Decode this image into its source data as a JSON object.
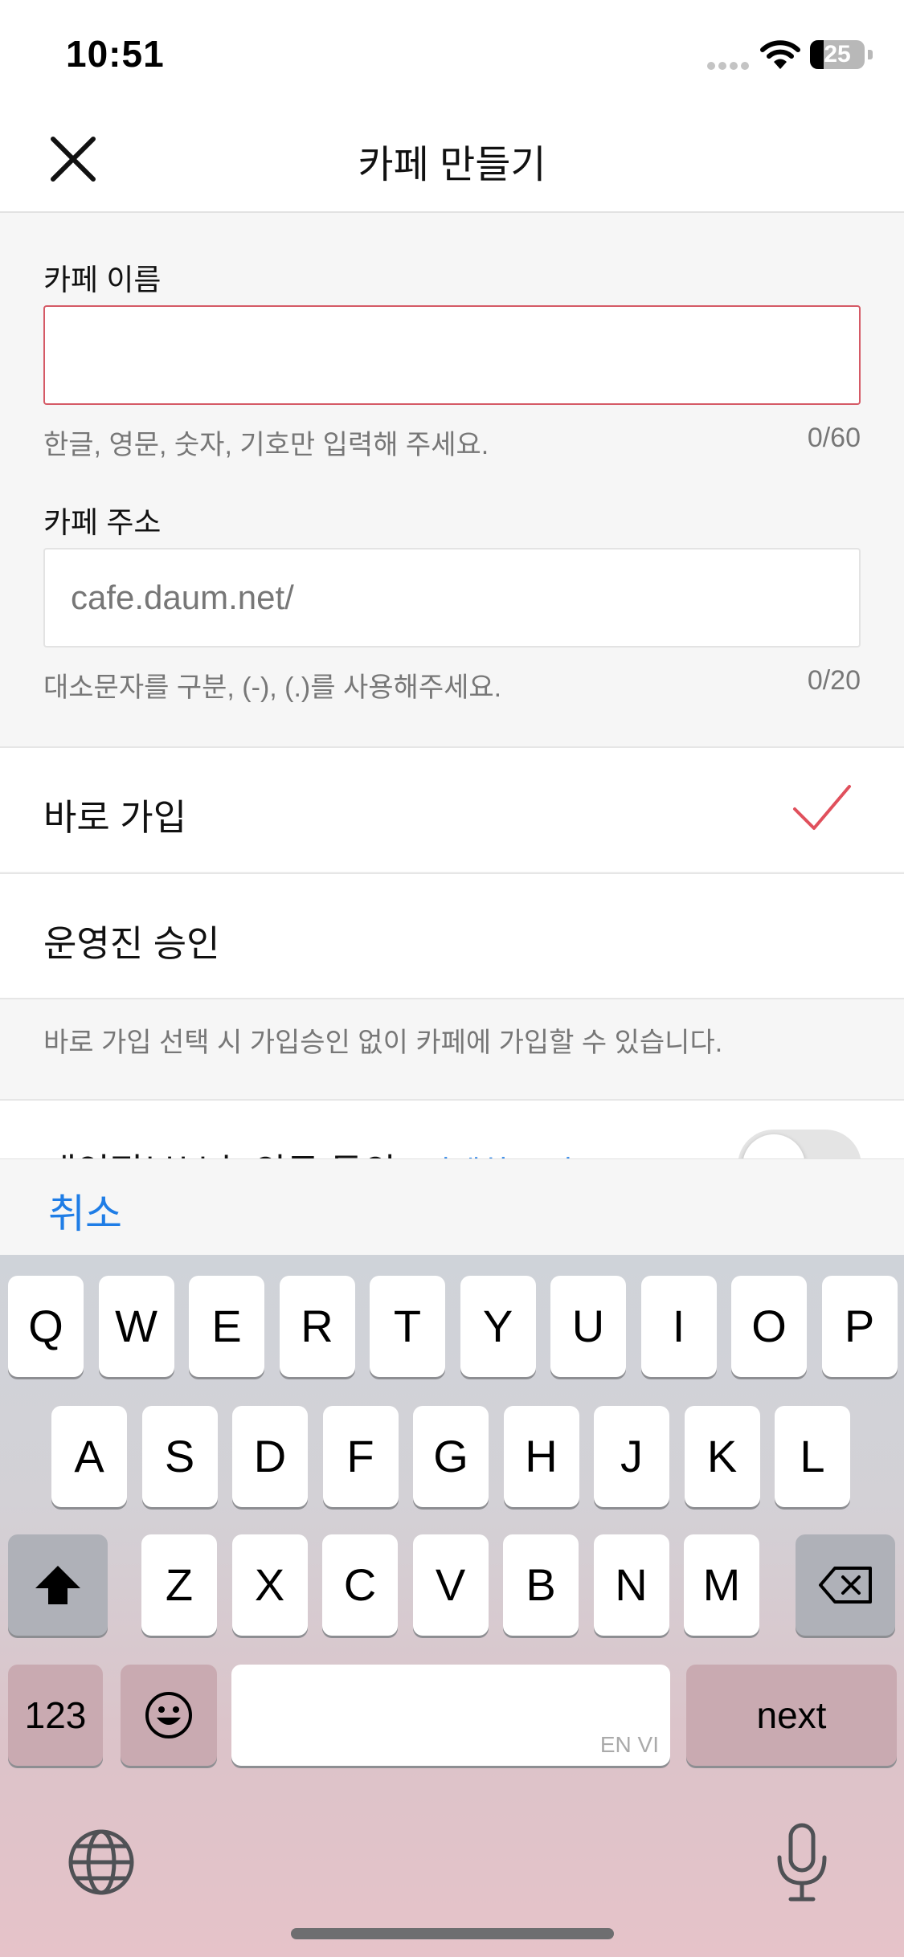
{
  "status_bar": {
    "time": "10:51",
    "battery_level": "25",
    "battery_fraction": 0.25
  },
  "nav": {
    "title": "카페 만들기",
    "close_icon": "close-icon"
  },
  "form": {
    "cafe_name": {
      "label": "카페 이름",
      "value": "",
      "placeholder": "",
      "helper": "한글, 영문, 숫자, 기호만 입력해 주세요.",
      "counter": "0/60",
      "error_color": "#d55a66"
    },
    "cafe_address": {
      "label": "카페 주소",
      "value": "",
      "placeholder": "cafe.daum.net/",
      "helper": "대소문자를 구분, (-), (.)를 사용해주세요.",
      "counter": "0/20"
    }
  },
  "join_options": {
    "items": [
      {
        "label": "바로 가입",
        "selected": true
      },
      {
        "label": "운영진 승인",
        "selected": false
      }
    ],
    "info": "바로 가입 선택 시 가입승인 없이 카페에 가입할 수 있습니다.",
    "check_color": "#e0505c"
  },
  "privacy": {
    "label": "개인정보보호 의무 동의",
    "link": "자세히 보기",
    "toggle_on": false
  },
  "accessory": {
    "cancel_label": "취소",
    "accent_color": "#1f7de6"
  },
  "keyboard": {
    "row1": [
      "Q",
      "W",
      "E",
      "R",
      "T",
      "Y",
      "U",
      "I",
      "O",
      "P"
    ],
    "row2": [
      "A",
      "S",
      "D",
      "F",
      "G",
      "H",
      "J",
      "K",
      "L"
    ],
    "row3": [
      "Z",
      "X",
      "C",
      "V",
      "B",
      "N",
      "M"
    ],
    "numbers_label": "123",
    "emoji_icon": "emoji-icon",
    "space_languages": "EN VI",
    "return_label": "next",
    "shift_icon": "shift-icon",
    "delete_icon": "backspace-icon",
    "globe_icon": "globe-icon",
    "mic_icon": "microphone-icon"
  }
}
